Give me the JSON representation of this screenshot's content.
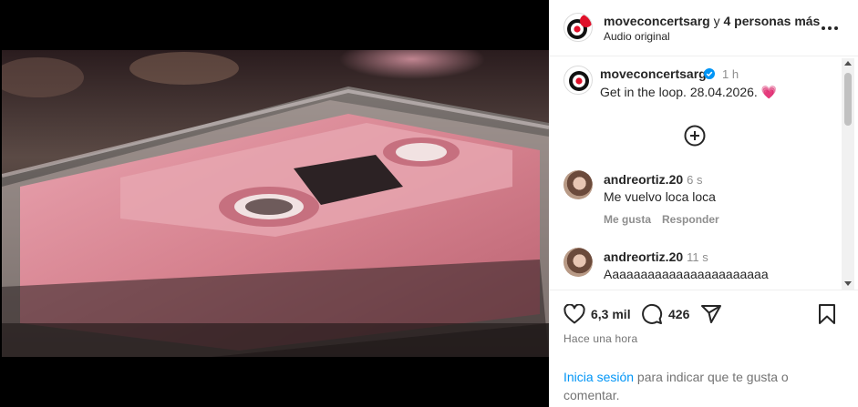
{
  "header": {
    "username": "moveconcertsarg",
    "connector": " y ",
    "collaborators": "4 personas más",
    "audio": "Audio original",
    "more_icon": "more-horizontal-icon"
  },
  "caption": {
    "username": "moveconcertsarg",
    "verified_icon": "verified-badge-icon",
    "time": "1 h",
    "text": "Get in the loop. 28.04.2026. 💗"
  },
  "load_more_icon": "plus-circle-icon",
  "comments": [
    {
      "username": "andreortiz.20",
      "time": "6 s",
      "text": "Me vuelvo loca loca",
      "like_label": "Me gusta",
      "reply_label": "Responder"
    },
    {
      "username": "andreortiz.20",
      "time": "11 s",
      "text": "Aaaaaaaaaaaaaaaaaaaaaaa"
    }
  ],
  "actions": {
    "likes": "6,3 mil",
    "comments": "426",
    "posted": "Hace una hora"
  },
  "login": {
    "link": "Inicia sesión",
    "text": " para indicar que te gusta o comentar."
  },
  "colors": {
    "link": "#0095f6",
    "brand_red": "#e0102a",
    "cassette_pink": "#d98a99"
  }
}
